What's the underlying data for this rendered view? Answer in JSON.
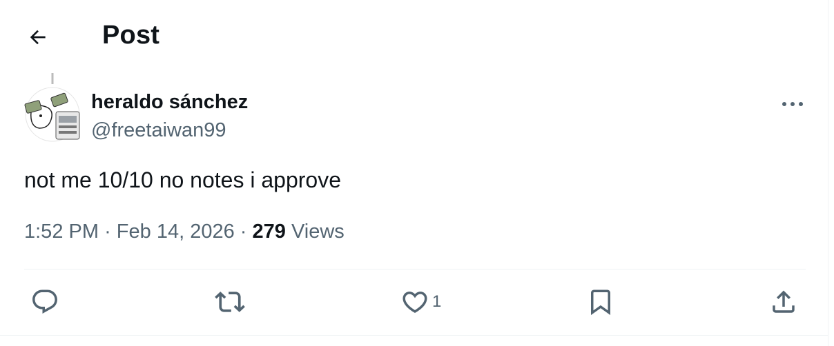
{
  "header": {
    "title": "Post",
    "back_icon": "arrow-left-icon"
  },
  "post": {
    "author": {
      "display_name": "heraldo sánchez",
      "handle": "@freetaiwan99"
    },
    "text": "not me 10/10 no notes i approve",
    "time": "1:52 PM",
    "date": "Feb 14, 2026",
    "separator": "·",
    "views_count": "279",
    "views_label": "Views"
  },
  "actions": {
    "reply_icon": "reply-icon",
    "repost_icon": "repost-icon",
    "like_icon": "heart-icon",
    "like_count": "1",
    "bookmark_icon": "bookmark-icon",
    "share_icon": "share-icon"
  },
  "colors": {
    "text_primary": "#0f1419",
    "text_secondary": "#536471",
    "divider": "#eff3f4"
  }
}
